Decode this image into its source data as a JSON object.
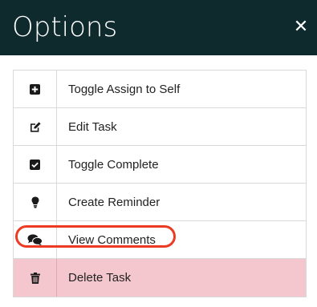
{
  "modal": {
    "title": "Options",
    "close_glyph": "✕"
  },
  "menu": {
    "items": [
      {
        "label": "Toggle Assign to Self",
        "icon": "plus-square-icon"
      },
      {
        "label": "Edit Task",
        "icon": "edit-icon"
      },
      {
        "label": "Toggle Complete",
        "icon": "check-square-icon"
      },
      {
        "label": "Create Reminder",
        "icon": "lightbulb-icon"
      },
      {
        "label": "View Comments",
        "icon": "comments-icon"
      },
      {
        "label": "Delete Task",
        "icon": "trash-icon"
      }
    ]
  },
  "colors": {
    "header_bg": "#0e2a2d",
    "danger_bg": "#f3c7cd",
    "highlight": "#ec3a23"
  }
}
